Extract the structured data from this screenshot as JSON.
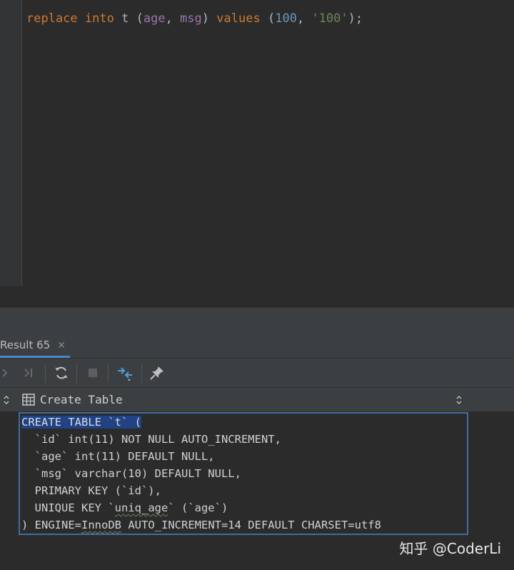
{
  "editor": {
    "code": {
      "t1": "replace",
      "t2": "into",
      "t3": "t",
      "t4": "(",
      "t5": "age",
      "t6": ",",
      "t7": "msg",
      "t8": ")",
      "t9": "values",
      "t10": "(",
      "t11": "100",
      "t12": ",",
      "t13": "'100'",
      "t14": ");"
    }
  },
  "results": {
    "tab_label": "Result 65",
    "tab_close": "✕",
    "view_label": "Create Table",
    "ddl": {
      "l1": "CREATE TABLE `t` (",
      "l2": "  `id` int(11) NOT NULL AUTO_INCREMENT,",
      "l3": "  `age` int(11) DEFAULT NULL,",
      "l4": "  `msg` varchar(10) DEFAULT NULL,",
      "l5": "  PRIMARY KEY (`id`),",
      "l6a": "  UNIQUE KEY `",
      "l6b": "uniq_age",
      "l6c": "` (`age`)",
      "l7a": ") ENGINE=",
      "l7b": "InnoDB",
      "l7c": " AUTO_INCREMENT=14 DEFAULT CHARSET=utf8"
    }
  },
  "watermark": "知乎 @CoderLi",
  "colors": {
    "keyword": "#cc7832",
    "column": "#9876aa",
    "number": "#6897bb",
    "string": "#6a8759",
    "selection": "#214283",
    "accent": "#4a88c7"
  },
  "icons": [
    "chevron-right-icon",
    "last-page-icon",
    "refresh-icon",
    "stop-icon",
    "compare-icon",
    "pin-icon",
    "table-icon",
    "sort-arrows-icon"
  ]
}
